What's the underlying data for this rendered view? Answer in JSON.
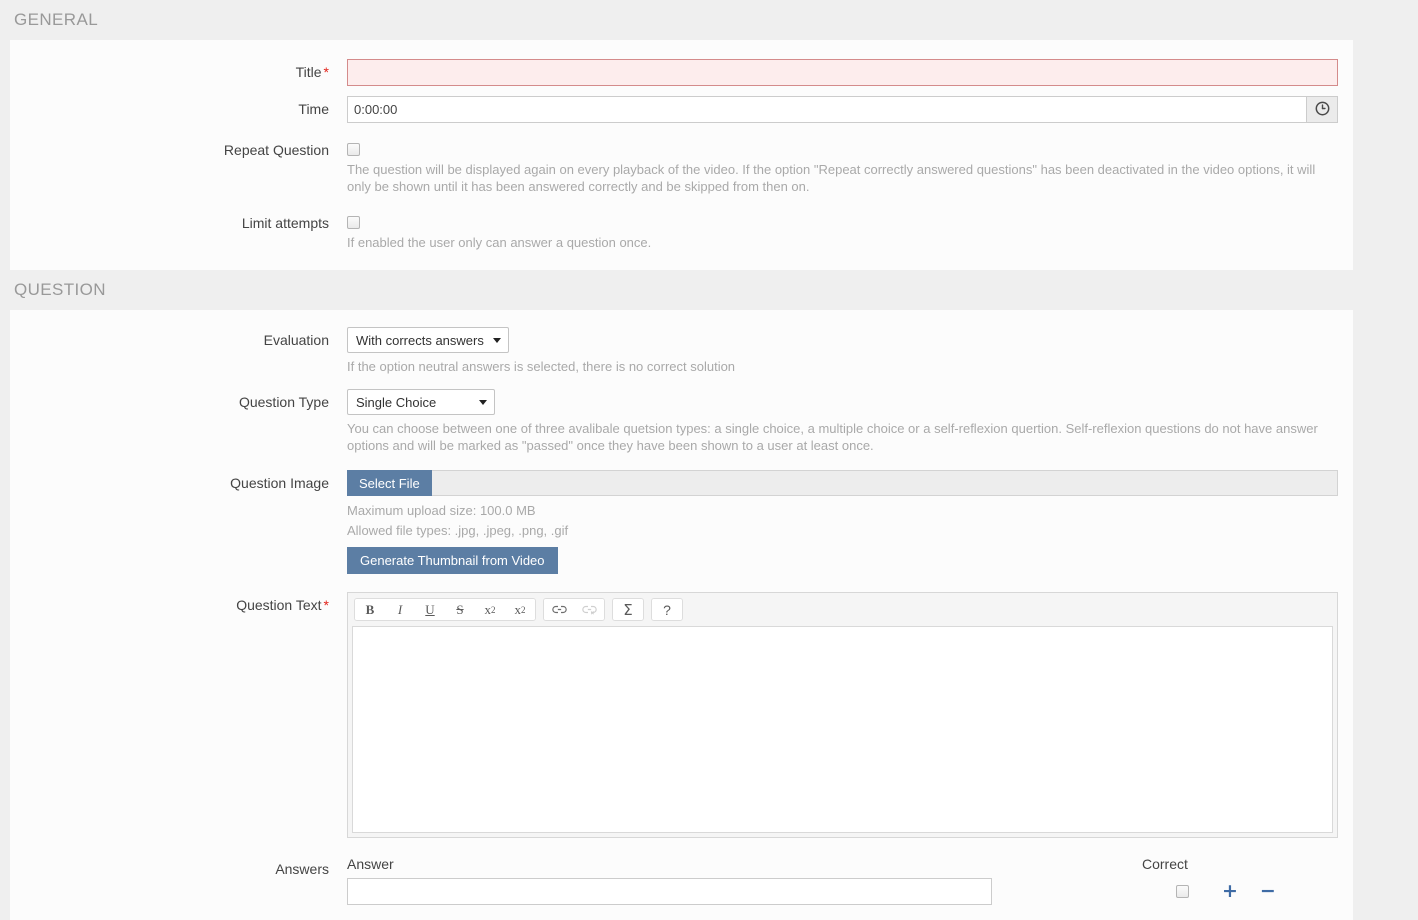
{
  "sections": {
    "general": {
      "title": "GENERAL",
      "fields": {
        "title": {
          "label": "Title",
          "required": "*",
          "value": "",
          "placeholder": ""
        },
        "time": {
          "label": "Time",
          "value": "0:00:00",
          "icon": "clock-icon"
        },
        "repeat_question": {
          "label": "Repeat Question",
          "help": "The question will be displayed again on every playback of the video. If the option \"Repeat correctly answered questions\" has been deactivated in the video options, it will only be shown until it has been answered correctly and be skipped from then on.",
          "checked": false
        },
        "limit_attempts": {
          "label": "Limit attempts",
          "help": "If enabled the user only can answer a question once.",
          "checked": false
        }
      }
    },
    "question": {
      "title": "QUESTION",
      "fields": {
        "evaluation": {
          "label": "Evaluation",
          "value": "With corrects answers",
          "options": [
            "With corrects answers"
          ],
          "help": "If the option neutral answers is selected, there is no correct solution"
        },
        "question_type": {
          "label": "Question Type",
          "value": "Single Choice",
          "options": [
            "Single Choice"
          ],
          "help": "You can choose between one of three avalibale quetsion types: a single choice, a multiple choice or a self-reflexion quertion. Self-reflexion questions do not have answer options and will be marked as \"passed\" once they have been shown to a user at least once."
        },
        "question_image": {
          "label": "Question Image",
          "select_file_label": "Select File",
          "filename": "",
          "max_size": "Maximum upload size: 100.0 MB",
          "allowed_types": "Allowed file types: .jpg, .jpeg, .png, .gif",
          "generate_thumbnail_label": "Generate Thumbnail from Video"
        },
        "question_text": {
          "label": "Question Text",
          "required": "*",
          "value": "",
          "toolbar": {
            "bold": "B",
            "italic": "I",
            "underline": "U",
            "strike": "S",
            "subscript_base": "x",
            "subscript_sub": "2",
            "superscript_base": "x",
            "superscript_sup": "2",
            "link": "link-icon",
            "unlink": "unlink-icon",
            "special_char": "Σ",
            "help": "?"
          }
        },
        "answers": {
          "label": "Answers",
          "column_answer": "Answer",
          "column_correct": "Correct",
          "rows": [
            {
              "answer": "",
              "correct": false
            }
          ],
          "add_label": "+",
          "remove_label": "−"
        }
      }
    }
  },
  "colors": {
    "page_background": "#efefef",
    "panel_background": "#fcfcfc",
    "accent_blue": "#5c7ea4",
    "required_red": "#e2231a",
    "error_field_background": "#fdeded",
    "icon_blue": "#3e6ba5"
  }
}
